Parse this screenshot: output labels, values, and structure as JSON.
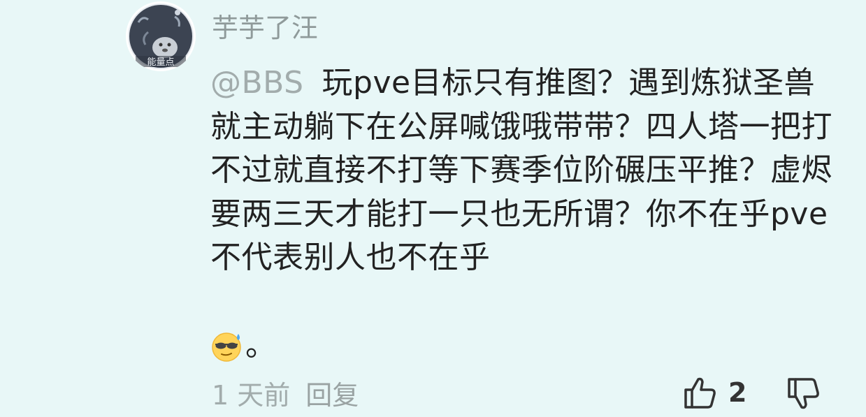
{
  "comment": {
    "username": "芋芋了汪",
    "avatar_caption": "能量点",
    "mention": "@BBS",
    "text": "玩pve目标只有推图？遇到炼狱圣兽就主动躺下在公屏喊饿哦带带？四人塔一把打不过就直接不打等下赛季位阶碾压平推？虚烬要两三天才能打一只也无所谓？你不在乎pve不代表别人也不在乎",
    "emoji": "sweating-sunglasses-emoji",
    "trailing_punctuation": "。",
    "time_ago": "1 天前",
    "reply_label": "回复",
    "like_count": "2"
  },
  "icons": {
    "like": "thumbs-up-icon",
    "dislike": "thumbs-down-icon"
  },
  "colors": {
    "background": "#e8f7f7",
    "username": "#8f9a9a",
    "text": "#222222",
    "muted": "#a2acac"
  }
}
